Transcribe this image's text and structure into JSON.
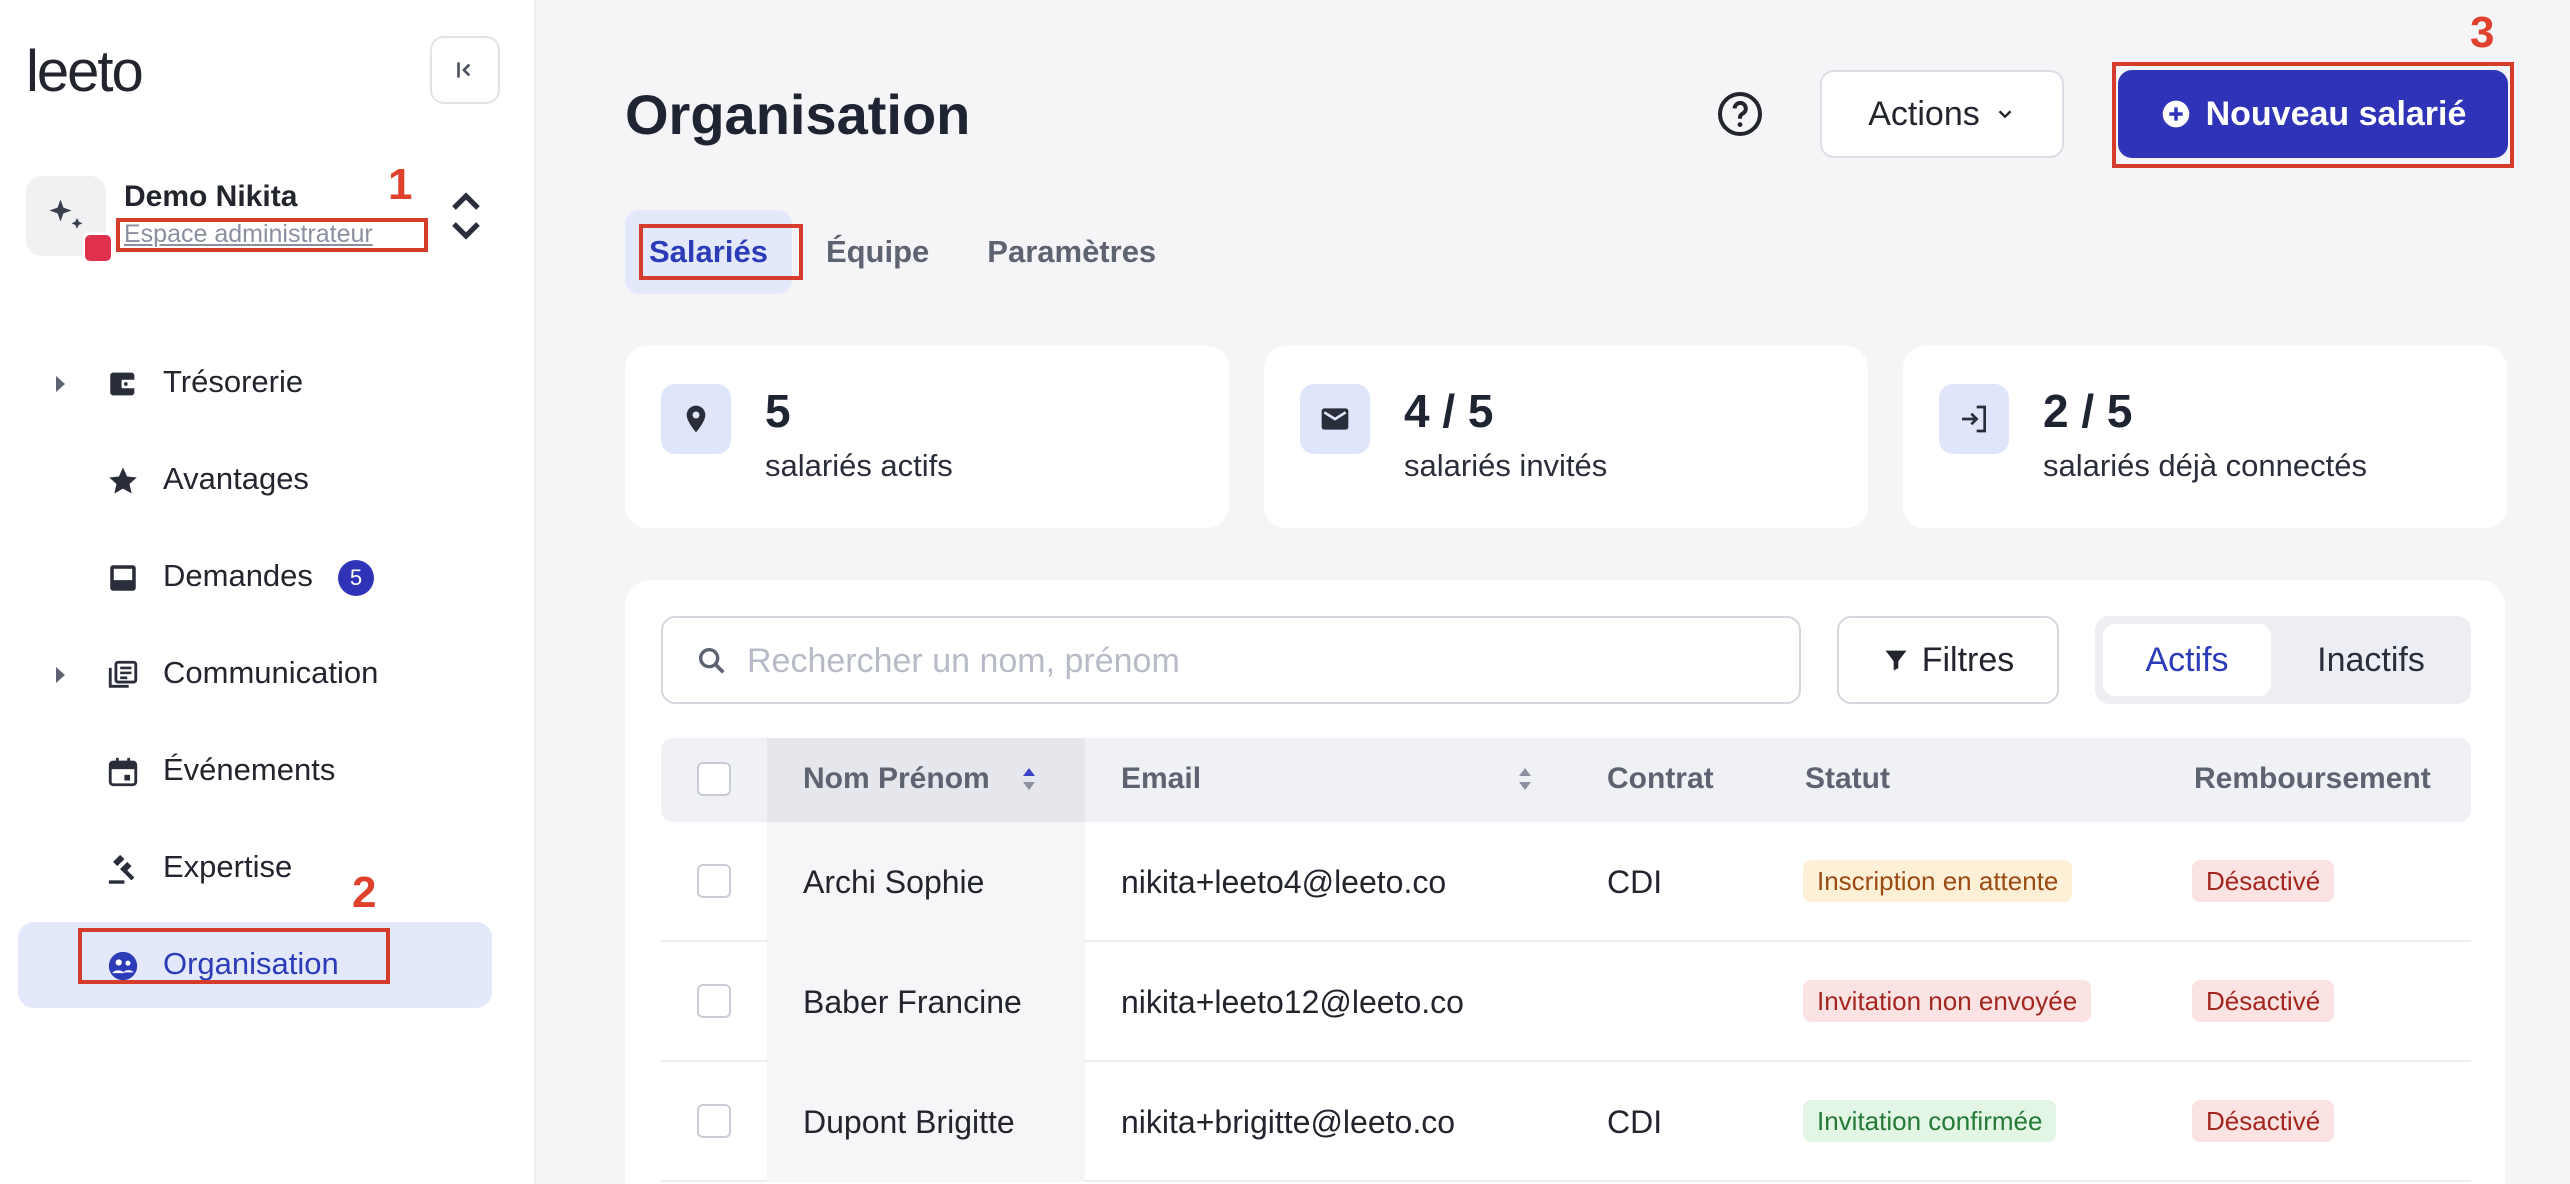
{
  "sidebar": {
    "logo": "leeto",
    "account": {
      "name": "Demo Nikita",
      "subtitle": "Espace administrateur"
    },
    "items": [
      {
        "label": "Trésorerie",
        "expandable": true,
        "icon": "wallet-icon"
      },
      {
        "label": "Avantages",
        "expandable": false,
        "icon": "star-icon"
      },
      {
        "label": "Demandes",
        "expandable": false,
        "icon": "inbox-icon",
        "count": "5"
      },
      {
        "label": "Communication",
        "expandable": true,
        "icon": "newspaper-icon"
      },
      {
        "label": "Événements",
        "expandable": false,
        "icon": "calendar-icon"
      },
      {
        "label": "Expertise",
        "expandable": false,
        "icon": "gavel-icon"
      },
      {
        "label": "Organisation",
        "expandable": false,
        "icon": "group-icon",
        "active": true
      }
    ]
  },
  "annotations": {
    "one": "1",
    "two": "2",
    "three": "3"
  },
  "header": {
    "title": "Organisation",
    "actions_label": "Actions",
    "new_label": "Nouveau salarié"
  },
  "tabs": [
    {
      "label": "Salariés",
      "active": true
    },
    {
      "label": "Équipe",
      "active": false
    },
    {
      "label": "Paramètres",
      "active": false
    }
  ],
  "stats": [
    {
      "value": "5",
      "label": "salariés actifs",
      "icon": "location-pin-icon"
    },
    {
      "value": "4 / 5",
      "label": "salariés invités",
      "icon": "mail-icon"
    },
    {
      "value": "2 / 5",
      "label": "salariés déjà connectés",
      "icon": "login-icon"
    }
  ],
  "toolbar": {
    "search_placeholder": "Rechercher un nom, prénom",
    "filters_label": "Filtres",
    "active_label": "Actifs",
    "inactive_label": "Inactifs"
  },
  "table": {
    "headers": {
      "name": "Nom Prénom",
      "email": "Email",
      "contract": "Contrat",
      "status": "Statut",
      "refund": "Remboursement"
    },
    "rows": [
      {
        "name": "Archi Sophie",
        "email": "nikita+leeto4@leeto.co",
        "contract": "CDI",
        "status": "Inscription en attente",
        "refund": "Désactivé"
      },
      {
        "name": "Baber Francine",
        "email": "nikita+leeto12@leeto.co",
        "contract": "",
        "status": "Invitation non envoyée",
        "refund": "Désactivé"
      },
      {
        "name": "Dupont Brigitte",
        "email": "nikita+brigitte@leeto.co",
        "contract": "CDI",
        "status": "Invitation confirmée",
        "refund": "Désactivé"
      }
    ]
  },
  "colors": {
    "primary": "#2f33b7",
    "annotation": "#d63c2b",
    "status_pending_bg": "#fdf0d6",
    "status_pending_fg": "#9b4a12",
    "status_not_sent_bg": "#fbe3e3",
    "status_not_sent_fg": "#a3261f",
    "status_confirmed_bg": "#e3f5e5",
    "status_confirmed_fg": "#237a36"
  }
}
